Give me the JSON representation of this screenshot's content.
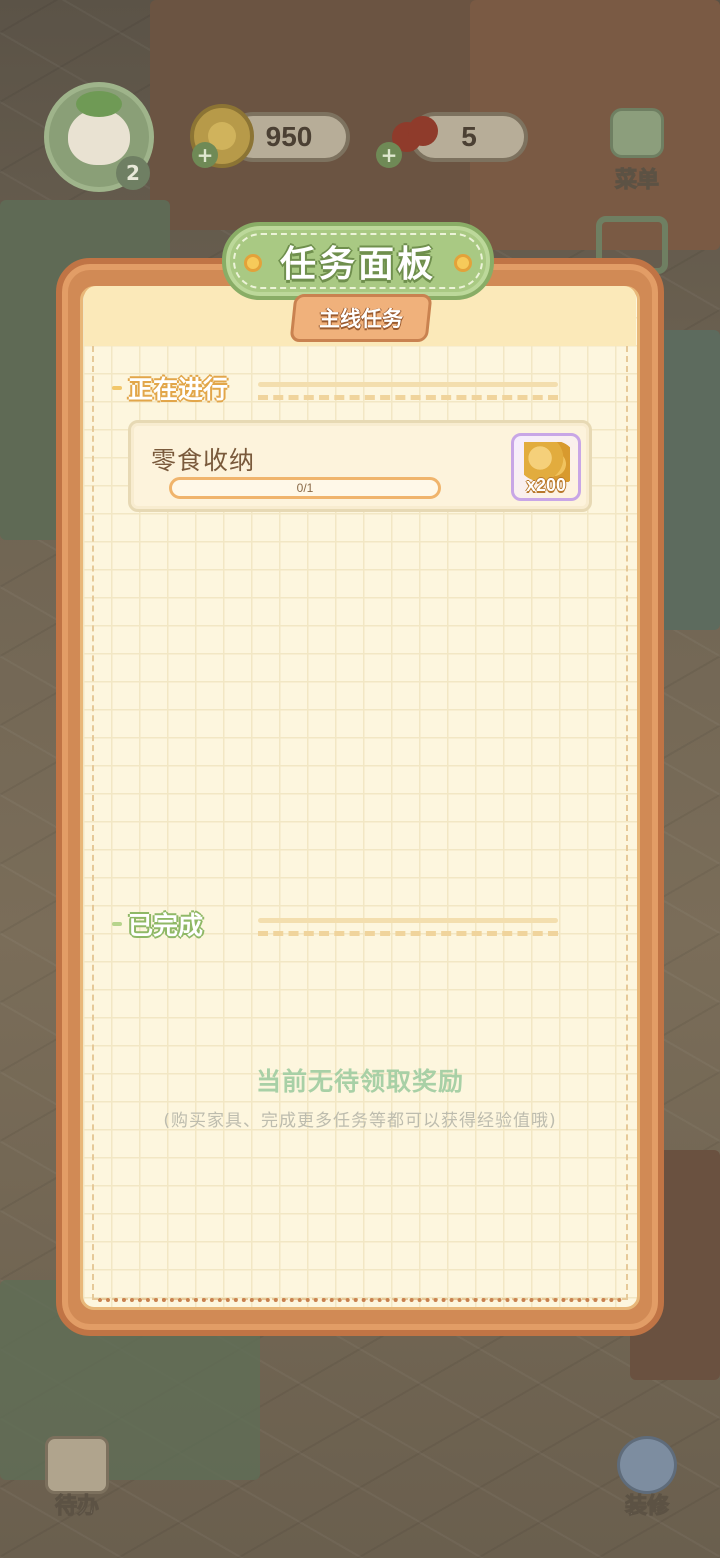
{
  "hud": {
    "level": "2",
    "coins": "950",
    "cherries": "5",
    "menu_label": "菜单"
  },
  "panel": {
    "title": "任务面板",
    "tab": "主线任务",
    "active_section": "正在进行",
    "done_section": "已完成",
    "tasks": [
      {
        "name": "零食收纳",
        "progress_text": "0/1",
        "progress_fraction": 0,
        "reward_qty": "x200",
        "reward_icon": "gold-coin-pile-icon"
      }
    ],
    "empty_title": "当前无待领取奖励",
    "empty_hint": "(购买家具、完成更多任务等都可以获得经验值哦)"
  },
  "bottom": {
    "todo_label": "待办",
    "decorate_label": "装修"
  },
  "colors": {
    "panel_frame": "#d18a55",
    "title_plaque": "#a9c983",
    "paper": "#fdf6de",
    "progress": "#f3b765",
    "empty_text": "#a8d0a6"
  }
}
